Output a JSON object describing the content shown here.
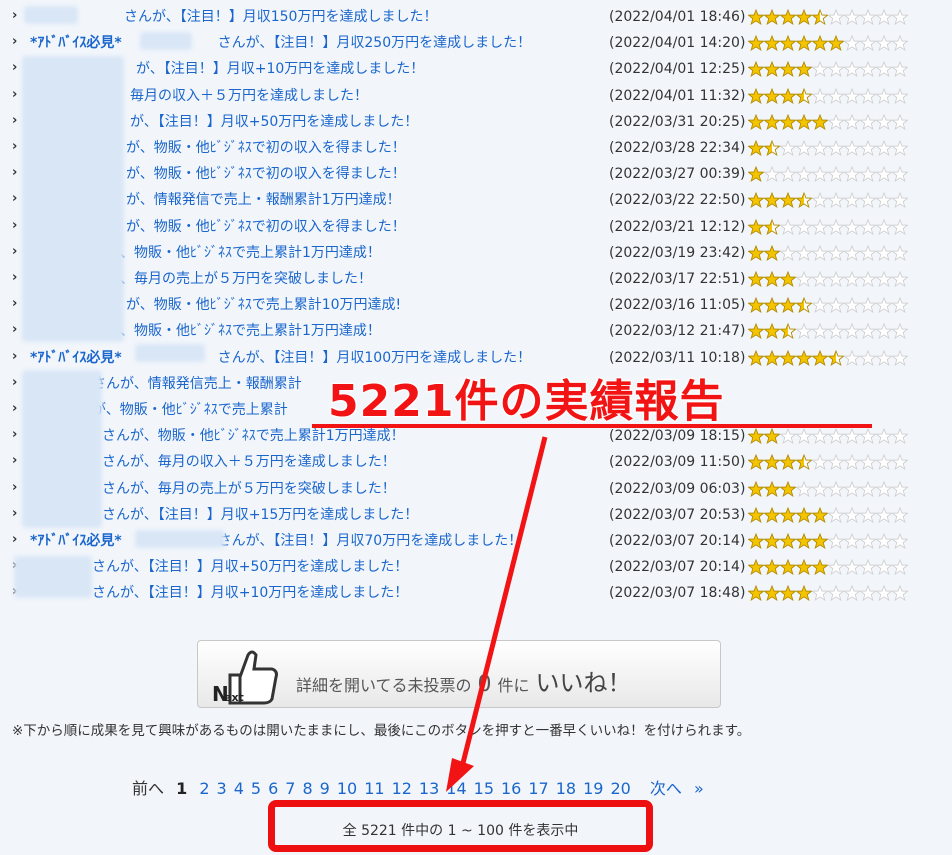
{
  "reports": [
    {
      "title": "さんが、【注目！】月収150万円を達成しました！",
      "date": "(2022/04/01 18:46)",
      "rating": 4.5
    },
    {
      "prefix": "*ｱﾄﾞﾊﾞｲｽ必見*",
      "title": "さんが、【注目！】月収250万円を達成しました！",
      "date": "(2022/04/01 14:20)",
      "rating": 6
    },
    {
      "title": "が、【注目！】月収+10万円を達成しました！",
      "date": "(2022/04/01 12:25)",
      "rating": 4
    },
    {
      "title": "毎月の収入＋５万円を達成しました！",
      "date": "(2022/04/01 11:32)",
      "rating": 3.5
    },
    {
      "title": "が、【注目！】月収+50万円を達成しました！",
      "date": "(2022/03/31 20:25)",
      "rating": 5
    },
    {
      "title": "が、物販・他ﾋﾞｼﾞﾈｽで初の収入を得ました！",
      "date": "(2022/03/28 22:34)",
      "rating": 1.5
    },
    {
      "title": "が、物販・他ﾋﾞｼﾞﾈｽで初の収入を得ました！",
      "date": "(2022/03/27 00:39)",
      "rating": 1
    },
    {
      "title": "が、情報発信で売上・報酬累計1万円達成！",
      "date": "(2022/03/22 22:50)",
      "rating": 3.5
    },
    {
      "title": "が、物販・他ﾋﾞｼﾞﾈｽで初の収入を得ました！",
      "date": "(2022/03/21 12:12)",
      "rating": 1.5
    },
    {
      "title": "、物販・他ﾋﾞｼﾞﾈｽで売上累計1万円達成！",
      "date": "(2022/03/19 23:42)",
      "rating": 2
    },
    {
      "title": "、毎月の売上が５万円を突破しました！",
      "date": "(2022/03/17 22:51)",
      "rating": 3
    },
    {
      "title": "が、物販・他ﾋﾞｼﾞﾈｽで売上累計10万円達成!",
      "date": "(2022/03/16 11:05)",
      "rating": 3.5
    },
    {
      "title": "、物販・他ﾋﾞｼﾞﾈｽで売上累計1万円達成！",
      "date": "(2022/03/12 21:47)",
      "rating": 2.5
    },
    {
      "prefix": "*ｱﾄﾞﾊﾞｲｽ必見*",
      "title": "さんが、【注目！】月収100万円を達成しました！",
      "date": "(2022/03/11 10:18)",
      "rating": 5.5
    },
    {
      "title": "さんが、情報発信売上・報酬累計",
      "date": "",
      "rating": 0
    },
    {
      "title": "が、物販・他ﾋﾞｼﾞﾈｽで売上累計",
      "date": "",
      "rating": 0
    },
    {
      "title": "さんが、物販・他ﾋﾞｼﾞﾈｽで売上累計1万円達成！",
      "date": "(2022/03/09 18:15)",
      "rating": 2
    },
    {
      "title": "さんが、毎月の収入＋５万円を達成しました！",
      "date": "(2022/03/09 11:50)",
      "rating": 3.5
    },
    {
      "title": "さんが、毎月の売上が５万円を突破しました！",
      "date": "(2022/03/09 06:03)",
      "rating": 3
    },
    {
      "title": "さんが、【注目！】月収+15万円を達成しました！",
      "date": "(2022/03/07 20:53)",
      "rating": 5
    },
    {
      "prefix": "*ｱﾄﾞﾊﾞｲｽ必見*",
      "title": "さんが、【注目！】月収70万円を達成しました！",
      "date": "(2022/03/07 20:14)",
      "rating": 5
    },
    {
      "title": "さんが、【注目！】月収+50万円を達成しました！",
      "date": "(2022/03/07 20:14)",
      "rating": 5
    },
    {
      "title": "さんが、【注目！】月収+10万円を達成しました！",
      "date": "(2022/03/07 18:48)",
      "rating": 4
    }
  ],
  "overlay": {
    "title": "5221件の実績報告"
  },
  "like_button": {
    "pre": "詳細を開いてる未投票の",
    "count": "0",
    "post": "件に",
    "strong": "いいね！",
    "icon_text": "Next"
  },
  "note": "※下から順に成果を見て興味があるものは開いたままにし、最後にこのボタンを押すと一番早くいいね！を付けられます。",
  "pager": {
    "prev": "前へ",
    "current": "1",
    "pages": [
      "2",
      "3",
      "4",
      "5",
      "6",
      "7",
      "8",
      "9",
      "10",
      "11",
      "12",
      "13",
      "14",
      "15",
      "16",
      "17",
      "18",
      "19",
      "20"
    ],
    "next": "次へ",
    "last": "»"
  },
  "summary": "全 5221 件中の 1 ~ 100 件を表示中",
  "colors": {
    "link": "#1a66cc",
    "accent_red": "#f21414",
    "star_gold": "#f5c400",
    "star_empty": "#cfcfcf"
  }
}
